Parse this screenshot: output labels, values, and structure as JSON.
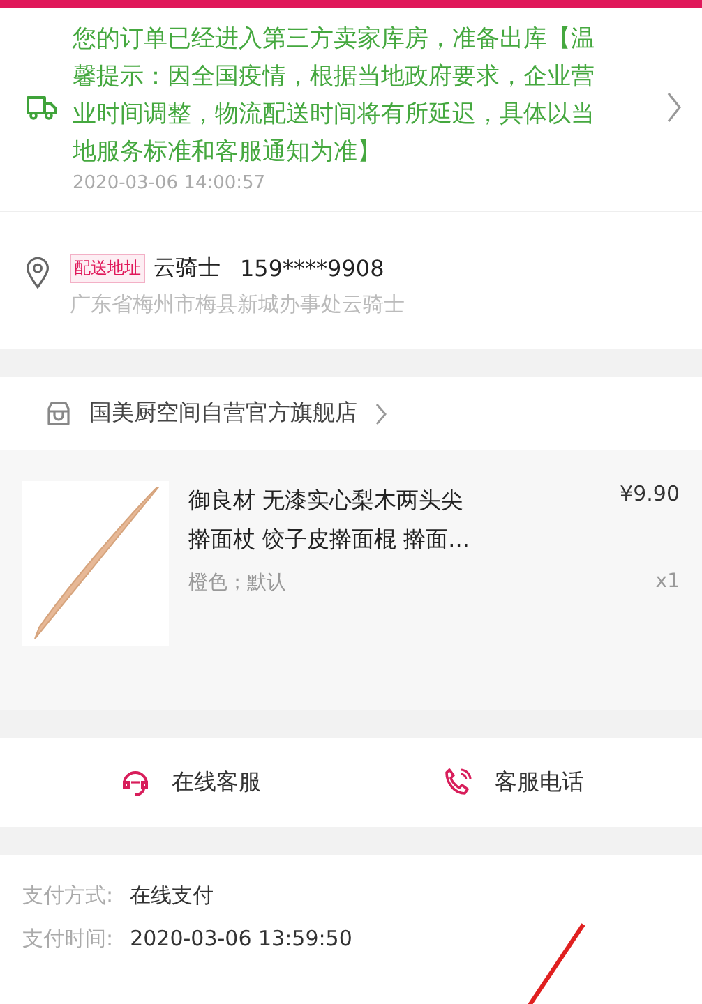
{
  "logistics": {
    "message": "您的订单已经进入第三方卖家库房，准备出库【温馨提示：因全国疫情，根据当地政府要求，企业营业时间调整，物流配送时间将有所延迟，具体以当地服务标准和客服通知为准】",
    "time": "2020-03-06 14:00:57"
  },
  "address": {
    "tag": "配送地址",
    "name": "云骑士",
    "phone": "159****9908",
    "detail": "广东省梅州市梅县新城办事处云骑士"
  },
  "store": {
    "name": "国美厨空间自营官方旗舰店"
  },
  "product": {
    "title_lines": [
      "御良材 无漆实心梨木两头尖",
      "擀面杖 饺子皮擀面棍 擀面..."
    ],
    "price": "¥9.90",
    "spec": "橙色；默认",
    "quantity": "x1"
  },
  "service": [
    {
      "kind": "chat",
      "label": "在线客服"
    },
    {
      "kind": "phone",
      "label": "客服电话"
    }
  ],
  "payment": [
    {
      "label": "支付方式:",
      "value": "在线支付"
    },
    {
      "label": "支付时间:",
      "value": "2020-03-06 13:59:50"
    }
  ]
}
